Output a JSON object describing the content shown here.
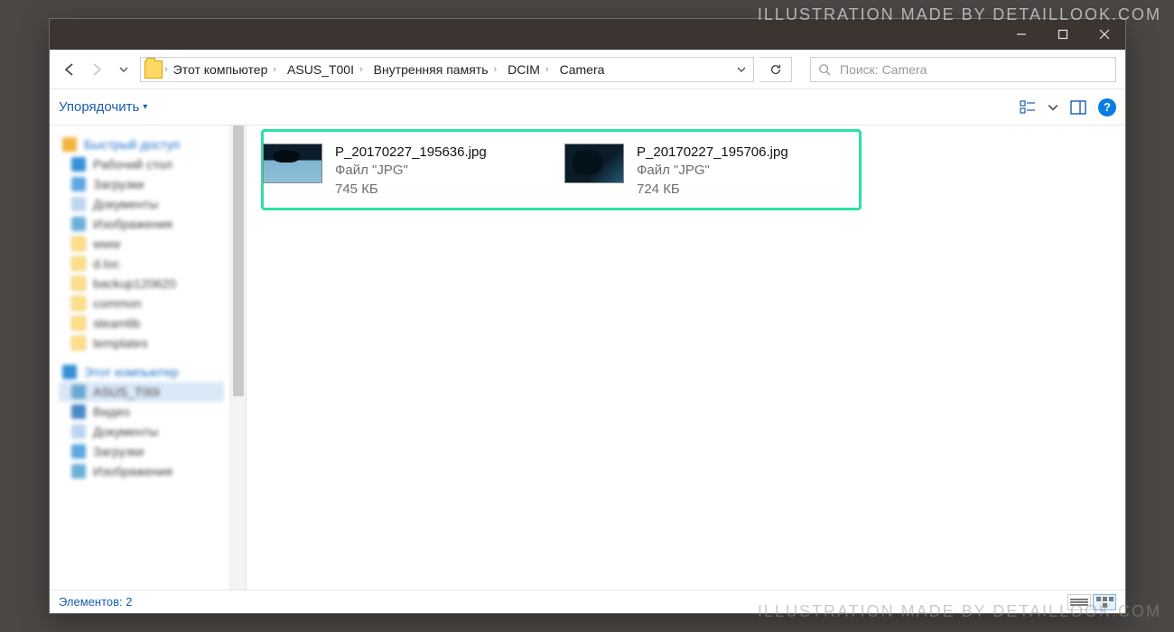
{
  "watermark_top": "ILLUSTRATION MADE BY DETAILLOOK.COM",
  "watermark_bottom": "ILLUSTRATION MADE BY DETAILLOOK.COM",
  "breadcrumb": {
    "items": [
      "Этот компьютер",
      "ASUS_T00I",
      "Внутренняя память",
      "DCIM",
      "Camera"
    ]
  },
  "search": {
    "placeholder": "Поиск: Camera"
  },
  "toolbar": {
    "organize": "Упорядочить"
  },
  "sidebar": {
    "quick": "Быстрый доступ",
    "desktop": "Рабочий стол",
    "downloads": "Загрузки",
    "documents": "Документы",
    "images": "Изображения",
    "f1": "www",
    "f2": "d.loc",
    "f3": "backup120620",
    "f4": "common",
    "f5": "steamlib",
    "f6": "templates",
    "thispc": "Этот компьютер",
    "device": "ASUS_T00I",
    "video": "Видео",
    "documents2": "Документы",
    "downloads2": "Загрузки",
    "images2": "Изображения"
  },
  "files": [
    {
      "name": "P_20170227_195636.jpg",
      "type": "Файл \"JPG\"",
      "size": "745 КБ"
    },
    {
      "name": "P_20170227_195706.jpg",
      "type": "Файл \"JPG\"",
      "size": "724 КБ"
    }
  ],
  "status": {
    "count": "Элементов: 2"
  }
}
